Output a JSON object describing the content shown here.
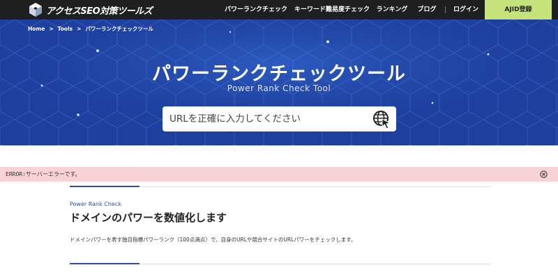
{
  "header": {
    "logo_text": "アクセスSEO対策ツールズ",
    "nav": [
      "パワーランクチェック",
      "キーワード難易度チェック",
      "ランキング",
      "ブログ",
      "ログイン"
    ],
    "register_label": "AJID登録"
  },
  "hero": {
    "breadcrumb": [
      "Home",
      "Tools",
      "パワーランクチェックツール"
    ],
    "breadcrumb_separator": ">",
    "title": "パワーランクチェックツール",
    "subtitle": "Power Rank Check Tool",
    "search_placeholder": "URLを正確に入力してください",
    "search_icon": "globe-cursor-icon"
  },
  "error": {
    "message": "ERROR:サーバーエラーです。",
    "close_icon": "close-circle-icon"
  },
  "section": {
    "kicker": "Power Rank Check",
    "heading": "ドメインのパワーを数値化します",
    "description": "ドメインパワーを表す独自指標パワーランク（100点満点）で、自身のURLや競合サイトのURLパワーをチェックします。"
  },
  "colors": {
    "header_bg": "#1f1f1f",
    "hero_bg": "#1d3f9e",
    "register_bg": "#c6e27a",
    "error_bg": "#f7d3d4",
    "accent": "#2d4fa7"
  }
}
